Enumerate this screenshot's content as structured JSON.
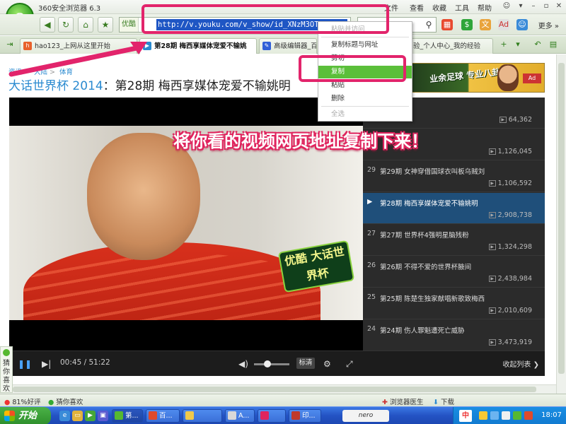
{
  "window": {
    "title": "360安全浏览器 6.3",
    "menu": [
      "文件",
      "查看",
      "收藏",
      "工具",
      "帮助"
    ]
  },
  "toolbar": {
    "site_tag": "优酷",
    "url": "http://v.youku.com/v_show/id_XNzM3OTQ",
    "more_label": "更多"
  },
  "tabs": [
    {
      "label": "hao123_上网从这里开始"
    },
    {
      "label": "第28期 梅西享媒体宠爱不输姚"
    },
    {
      "label": "高级编辑器_百"
    },
    {
      "label": "验_个人中心_我的经验"
    }
  ],
  "page": {
    "breadcrumb": [
      "资讯",
      ">",
      "大陆",
      ">",
      "体育"
    ],
    "title_brand": "大话世界杯 2014",
    "title_sep": "：",
    "title_episode": "第28期 梅西享媒体宠爱不输姚明",
    "banner_text": "业余足球 专业八卦",
    "banner_badge": "Ad"
  },
  "context_menu": {
    "items": [
      "粘贴并访问",
      "复制标题与网址",
      "剪切",
      "复制",
      "粘贴",
      "删除",
      "全选"
    ]
  },
  "annotation": {
    "overlay_text": "将你看的视频网页地址复制下来！"
  },
  "video": {
    "badge_text": "优酷 大话世界杯"
  },
  "playlist": {
    "items": [
      {
        "num": "",
        "title": "",
        "count": "64,362"
      },
      {
        "num": "",
        "title": "",
        "count": "1,126,045"
      },
      {
        "num": "29",
        "title": "第29期 女神穿借国球衣叫板乌贼刘",
        "count": "1,106,592"
      },
      {
        "num": "",
        "title": "第28期 梅西享媒体宠爱不输姚明",
        "count": "2,908,738"
      },
      {
        "num": "27",
        "title": "第27期 世界杯4强明星脑残粉",
        "count": "1,324,298"
      },
      {
        "num": "26",
        "title": "第26期 不得不爱的世界杯腋间",
        "count": "2,438,984"
      },
      {
        "num": "25",
        "title": "第25期 陈楚生独家献唱新歌致梅西",
        "count": "2,010,609"
      },
      {
        "num": "24",
        "title": "第24期 伤人罪魁遭死亡威胁",
        "count": "3,473,919"
      }
    ]
  },
  "player": {
    "time": "00:45 / 51:22",
    "quality": "标清",
    "collapse_label": "收起列表"
  },
  "side_widget": {
    "text": "猜你喜欢"
  },
  "status": {
    "rating": "81%好评",
    "guess": "猜你喜欢",
    "doctor": "浏览器医生",
    "download": "下载"
  },
  "taskbar": {
    "start": "开始",
    "tasks": [
      "第...",
      "百...",
      "",
      "A...",
      "",
      "印..."
    ],
    "nero": "nero",
    "ime": "中",
    "clock": "18:07"
  }
}
